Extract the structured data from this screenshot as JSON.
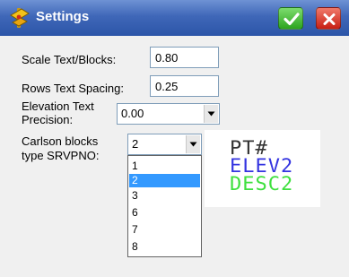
{
  "window": {
    "title": "Settings",
    "app_icon": "carlson-app-icon",
    "ok_icon": "checkmark-icon",
    "close_icon": "close-x-icon"
  },
  "form": {
    "scale_label": "Scale Text/Blocks:",
    "scale_value": "0.80",
    "rows_label": "Rows Text Spacing:",
    "rows_value": "0.25",
    "elevation_label_line1": "Elevation Text",
    "elevation_label_line2": "Precision:",
    "elevation_value": "0.00",
    "blocks_label_line1": "Carlson blocks",
    "blocks_label_line2": "type SRVPNO:",
    "blocks_value": "2",
    "blocks_options": [
      "1",
      "2",
      "3",
      "6",
      "7",
      "8"
    ],
    "blocks_selected_index": 1
  },
  "preview": {
    "line1": "PT#",
    "line2": "ELEV2",
    "line3": "DESC2",
    "colors": {
      "line1": "#333333",
      "line2": "#3434e0",
      "line3": "#3fe03f"
    }
  },
  "colors": {
    "titlebar": "#3f67b8",
    "ok_button": "#2da41f",
    "close_button": "#c81f14",
    "selection": "#3399ff"
  }
}
